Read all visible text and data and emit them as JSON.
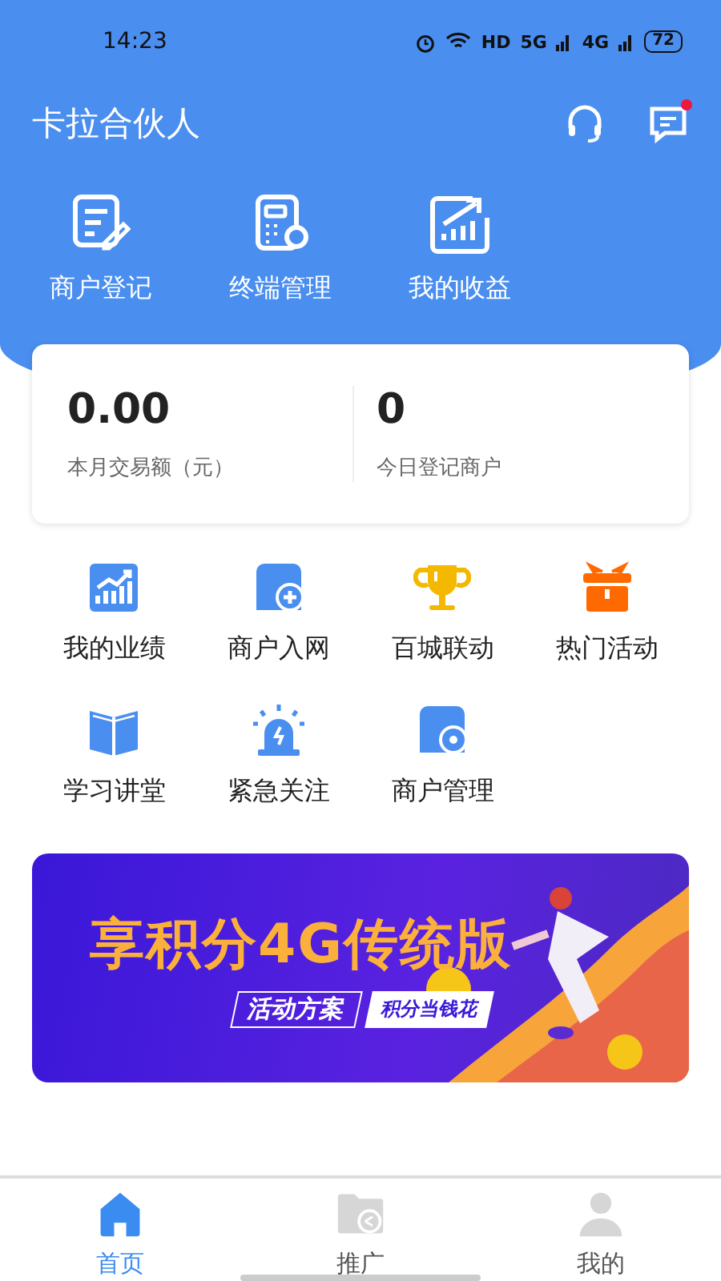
{
  "status_bar": {
    "time": "14:23",
    "network": "HD",
    "signal_1": "5G",
    "signal_2": "4G",
    "battery": "72"
  },
  "header": {
    "title": "卡拉合伙人",
    "messages_unread": true
  },
  "quick_actions": [
    {
      "label": "商户登记"
    },
    {
      "label": "终端管理"
    },
    {
      "label": "我的收益"
    }
  ],
  "summary": [
    {
      "value": "0.00",
      "label": "本月交易额（元）"
    },
    {
      "value": "0",
      "label": "今日登记商户"
    }
  ],
  "grid": [
    {
      "label": "我的业绩"
    },
    {
      "label": "商户入网"
    },
    {
      "label": "百城联动"
    },
    {
      "label": "热门活动"
    },
    {
      "label": "学习讲堂"
    },
    {
      "label": "紧急关注"
    },
    {
      "label": "商户管理"
    }
  ],
  "banner": {
    "headline": "享积分4G传统版",
    "tag_1": "活动方案",
    "tag_2": "积分当钱花"
  },
  "tabs": [
    {
      "label": "首页",
      "selected": true
    },
    {
      "label": "推广",
      "selected": false
    },
    {
      "label": "我的",
      "selected": false
    }
  ]
}
